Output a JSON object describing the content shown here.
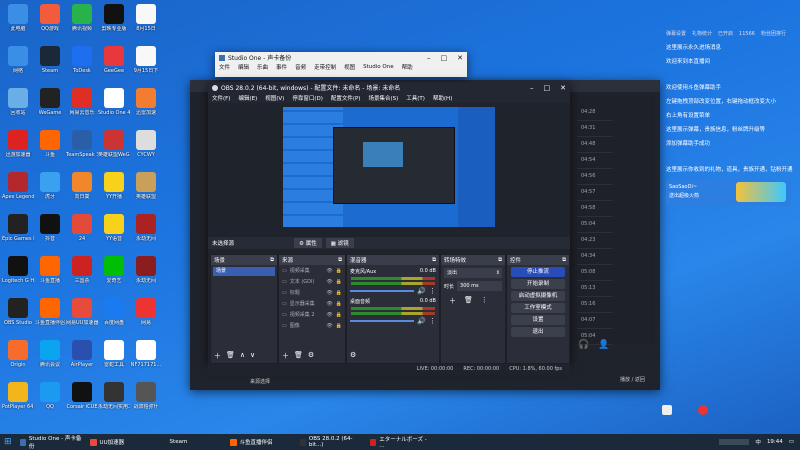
{
  "desktop_icons": [
    {
      "label": "此电脑",
      "color": "#3a8ee6"
    },
    {
      "label": "QQ游戏",
      "color": "#f25c3c"
    },
    {
      "label": "腾讯视频",
      "color": "#28b34a"
    },
    {
      "label": "剪映专业版",
      "color": "#111"
    },
    {
      "label": "8月15日",
      "color": "#f8f8f8"
    },
    {
      "label": "网络",
      "color": "#3a8ee6"
    },
    {
      "label": "Steam",
      "color": "#1b2838"
    },
    {
      "label": "ToDesk",
      "color": "#1e6ff0"
    },
    {
      "label": "GeeGee",
      "color": "#e8383d"
    },
    {
      "label": "9月15日下",
      "color": "#f8f8f8"
    },
    {
      "label": "回收站",
      "color": "#6aaee8"
    },
    {
      "label": "WeGame",
      "color": "#222"
    },
    {
      "label": "网易云音乐",
      "color": "#e02e24"
    },
    {
      "label": "Studio One 4",
      "color": "#fff"
    },
    {
      "label": "迅雷加速",
      "color": "#f27c30"
    },
    {
      "label": "迅游加速器",
      "color": "#d22"
    },
    {
      "label": "斗鱼",
      "color": "#f60"
    },
    {
      "label": "TeamSpeak 3",
      "color": "#2a5fa8"
    },
    {
      "label": "英雄联盟WeGame",
      "color": "#c33"
    },
    {
      "label": "CYCWY",
      "color": "#ddd"
    },
    {
      "label": "Apex Legends",
      "color": "#b3282d"
    },
    {
      "label": "虎牙",
      "color": "#3aa0f0"
    },
    {
      "label": "向日葵",
      "color": "#f2862b"
    },
    {
      "label": "YY开播",
      "color": "#f7d11a"
    },
    {
      "label": "英雄联盟",
      "color": "#c8a05a"
    },
    {
      "label": "Epic Games Launcher",
      "color": "#222"
    },
    {
      "label": "抖音",
      "color": "#111"
    },
    {
      "label": "24",
      "color": "#e24a3a"
    },
    {
      "label": "YY语音",
      "color": "#f7d11a"
    },
    {
      "label": "永劫无间",
      "color": "#a22"
    },
    {
      "label": "Logitech G HUB",
      "color": "#111"
    },
    {
      "label": "斗鱼直播",
      "color": "#f60"
    },
    {
      "label": "三国杀",
      "color": "#c22"
    },
    {
      "label": "爱奇艺",
      "color": "#00be06"
    },
    {
      "label": "永劫无间",
      "color": "#8a1e1e"
    },
    {
      "label": "OBS Studio",
      "color": "#222"
    },
    {
      "label": "斗鱼直播伴侣",
      "color": "#f60"
    },
    {
      "label": "网易UU加速器",
      "color": "#e84b3c"
    },
    {
      "label": "百度网盘",
      "color": "#1a7af0"
    },
    {
      "label": "网易",
      "color": "#e33"
    },
    {
      "label": "Origin",
      "color": "#f56c2d"
    },
    {
      "label": "腾讯会议",
      "color": "#0aa4f0"
    },
    {
      "label": "AirPlayer",
      "color": "#2a4fae"
    },
    {
      "label": "雷蛇工具",
      "color": "#fff"
    },
    {
      "label": "NF717171...",
      "color": "#fff"
    },
    {
      "label": "PotPlayer 64 bit",
      "color": "#f3b51c"
    },
    {
      "label": "QQ",
      "color": "#1a9af0"
    },
    {
      "label": "Corsair iCUE",
      "color": "#111"
    },
    {
      "label": "永劫无间实用工具",
      "color": "#333"
    },
    {
      "label": "战双帕弥什",
      "color": "#555"
    }
  ],
  "studio_one": {
    "title": "Studio One - 声卡备份",
    "menu": [
      "文件",
      "编辑",
      "乐曲",
      "事件",
      "音频",
      "走带控制",
      "视图",
      "Studio One",
      "帮助"
    ]
  },
  "obs": {
    "title": "OBS 28.0.2 (64-bit, windows) - 配置文件: 未命名 - 场景: 未命名",
    "menu": [
      "文件(F)",
      "编辑(E)",
      "视图(V)",
      "停靠窗口(D)",
      "配置文件(P)",
      "场景集合(S)",
      "工具(T)",
      "帮助(H)"
    ],
    "no_source": "未选择源",
    "props_btn": "属性",
    "filters_btn": "滤镜",
    "scenes_title": "场景",
    "scene_item": "场景",
    "sources_title": "来源",
    "sources": [
      "视频采集",
      "文本 (GDI)",
      "标题",
      "显示器采集",
      "视频采集 2",
      "图像"
    ],
    "mixer_title": "混音器",
    "mixer": [
      {
        "name": "麦克风/Aux",
        "db": "0.0 dB"
      },
      {
        "name": "桌面音频",
        "db": "0.0 dB"
      }
    ],
    "transitions_title": "转场特效",
    "transition": "淡出",
    "duration_label": "时长",
    "duration": "300 ms",
    "controls_title": "控件",
    "controls": [
      "停止推流",
      "开始录制",
      "启动虚拟摄像机",
      "工作室模式",
      "设置",
      "退出"
    ],
    "status": {
      "live": "LIVE: 00:00:00",
      "rec": "REC: 00:00:00",
      "cpu": "CPU: 1.8%, 60.00 fps"
    }
  },
  "time_list": [
    "04:28",
    "04:31",
    "04:48",
    "04:54",
    "04:56",
    "04:57",
    "04:58",
    "05:04",
    "04:23",
    "04:34",
    "05:08",
    "05:13",
    "05:16",
    "04:07",
    "05:04"
  ],
  "background_window": {
    "bottom_label": "来源选择",
    "right_label": "播放 / 返回"
  },
  "chat": {
    "top": [
      "弹幕设置",
      "礼物统计",
      "已开启",
      "11566",
      "粉丝团排行"
    ],
    "lines": [
      "这里展示永久进场消息",
      "欢迎来到本直播间",
      "欢迎使用斗鱼弹幕助手",
      "左键拖拽顶部改变位置，右键拖动框改变大小",
      "右上角有设置菜单",
      "这里展示弹幕，贵族信息，粉丝牌升级等",
      "添加弹幕助手成功",
      "这里展示你收到的礼物，道具，贵族开通，钻粉开通",
      "SaoSaoDi~",
      "送出超级火箭"
    ]
  },
  "taskbar": {
    "items": [
      {
        "label": "Studio One - 声卡备份",
        "color": "#3a6fb0"
      },
      {
        "label": "UU加速器",
        "color": "#e84b3c"
      },
      {
        "label": "Steam",
        "color": "#1b2838"
      },
      {
        "label": "斗鱼直播伴侣",
        "color": "#f60"
      },
      {
        "label": "OBS 28.0.2 (64-bit...)",
        "color": "#333"
      },
      {
        "label": "エターナルボーズ - ...",
        "color": "#c22"
      }
    ],
    "time": "19:44",
    "ime": "中"
  }
}
